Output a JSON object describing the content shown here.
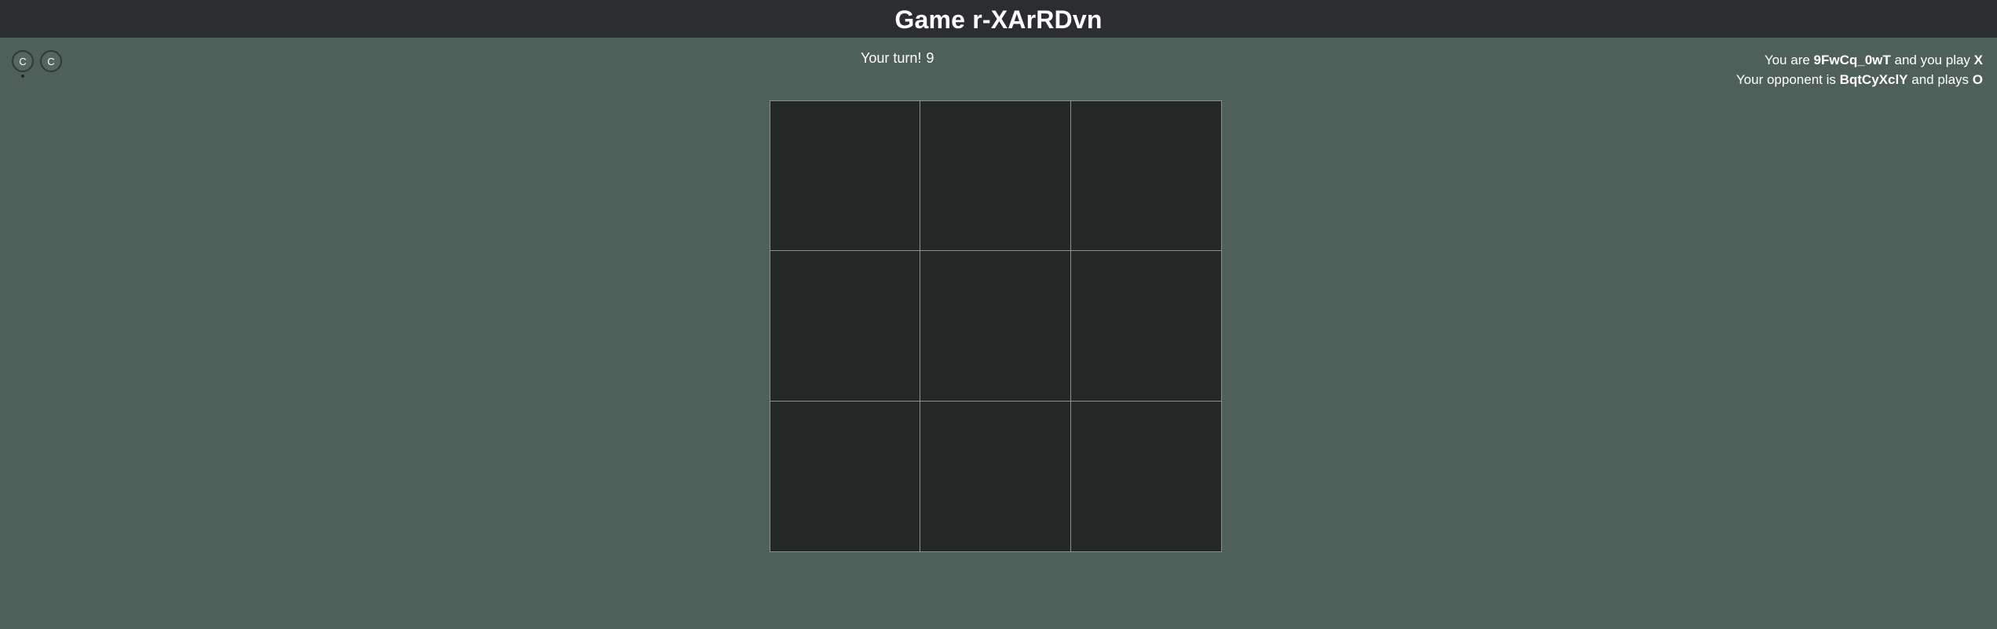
{
  "header": {
    "title": "Game r-XArRDvn"
  },
  "avatars": [
    {
      "initial": "C",
      "active": true
    },
    {
      "initial": "C",
      "active": false
    }
  ],
  "turn": {
    "label": "Your turn!",
    "count": "9"
  },
  "players": {
    "you_prefix": "You are ",
    "you_name": "9FwCq_0wT",
    "you_middle": " and you play ",
    "you_symbol": "X",
    "opp_prefix": "Your opponent is ",
    "opp_name": "BqtCyXclY",
    "opp_middle": " and plays ",
    "opp_symbol": "O"
  },
  "board": {
    "cells": [
      "",
      "",
      "",
      "",
      "",
      "",
      "",
      "",
      ""
    ]
  },
  "colors": {
    "page_background": "#4f5f59",
    "header_background": "#2b2d31",
    "board_cell": "#262828",
    "grid_line": "#8b918e"
  }
}
